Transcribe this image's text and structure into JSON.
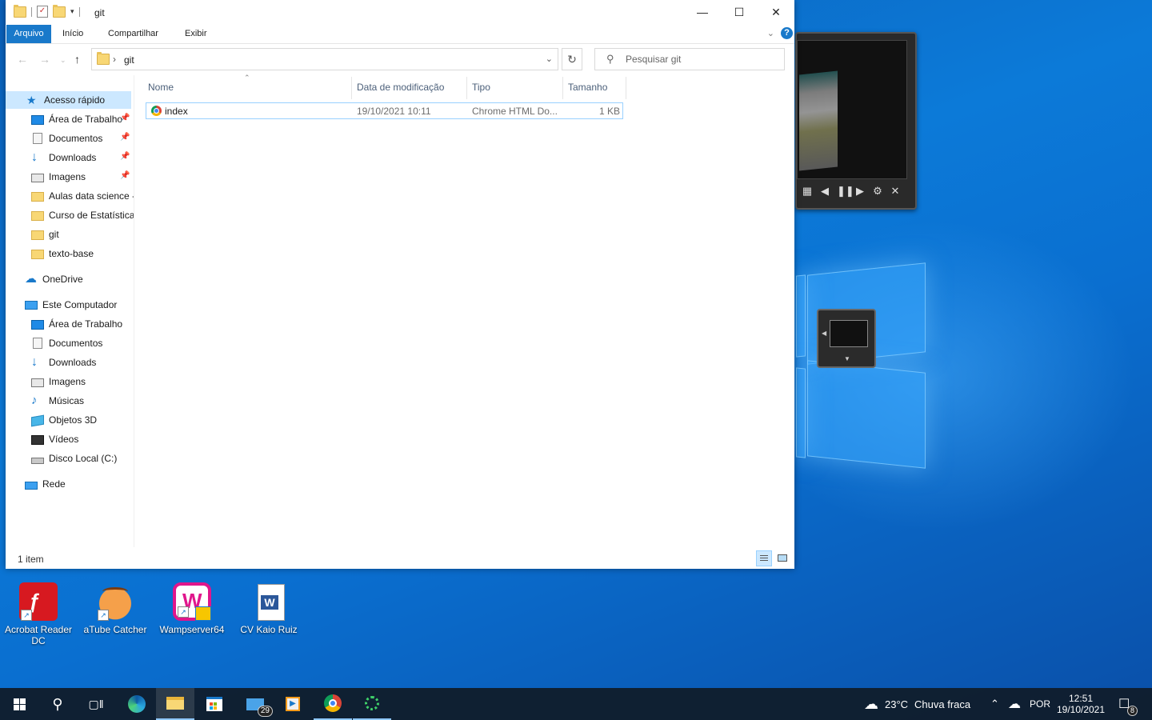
{
  "explorer": {
    "title": "git",
    "ribbon_tabs": [
      "Arquivo",
      "Início",
      "Compartilhar",
      "Exibir"
    ],
    "help_label": "?",
    "address": {
      "path": "git"
    },
    "search": {
      "placeholder": "Pesquisar git"
    },
    "sidebar": {
      "items": [
        {
          "label": "Acesso rápido",
          "icon": "star-icon",
          "pinned": false,
          "selected": true
        },
        {
          "label": "Área de Trabalho",
          "icon": "desktop-icon",
          "pinned": true
        },
        {
          "label": "Documentos",
          "icon": "documents-icon",
          "pinned": true
        },
        {
          "label": "Downloads",
          "icon": "downloads-icon",
          "pinned": true
        },
        {
          "label": "Imagens",
          "icon": "pictures-icon",
          "pinned": true
        },
        {
          "label": "Aulas data science -",
          "icon": "folder-icon",
          "pinned": false
        },
        {
          "label": "Curso de Estatística",
          "icon": "folder-icon",
          "pinned": false
        },
        {
          "label": "git",
          "icon": "folder-icon",
          "pinned": false
        },
        {
          "label": "texto-base",
          "icon": "folder-icon",
          "pinned": false
        },
        {
          "label": "OneDrive",
          "icon": "cloud-icon",
          "pinned": false
        },
        {
          "label": "Este Computador",
          "icon": "computer-icon",
          "pinned": false
        },
        {
          "label": "Área de Trabalho",
          "icon": "desktop-icon",
          "pinned": false
        },
        {
          "label": "Documentos",
          "icon": "documents-icon",
          "pinned": false
        },
        {
          "label": "Downloads",
          "icon": "downloads-icon",
          "pinned": false
        },
        {
          "label": "Imagens",
          "icon": "pictures-icon",
          "pinned": false
        },
        {
          "label": "Músicas",
          "icon": "music-icon",
          "pinned": false
        },
        {
          "label": "Objetos 3D",
          "icon": "3d-objects-icon",
          "pinned": false
        },
        {
          "label": "Vídeos",
          "icon": "videos-icon",
          "pinned": false
        },
        {
          "label": "Disco Local (C:)",
          "icon": "drive-icon",
          "pinned": false
        },
        {
          "label": "Rede",
          "icon": "network-icon",
          "pinned": false
        }
      ]
    },
    "columns": [
      "Nome",
      "Data de modificação",
      "Tipo",
      "Tamanho"
    ],
    "files": [
      {
        "name": "index",
        "modified": "19/10/2021 10:11",
        "type": "Chrome HTML Do...",
        "size": "1 KB",
        "icon": "chrome-icon"
      }
    ],
    "status": "1 item"
  },
  "desktop_icons": [
    {
      "label": "Acrobat Reader DC",
      "icon": "acrobat-icon"
    },
    {
      "label": "aTube Catcher",
      "icon": "atube-icon"
    },
    {
      "label": "Wampserver64",
      "icon": "wampserver-icon"
    },
    {
      "label": "CV Kaio Ruiz",
      "icon": "word-doc-icon"
    }
  ],
  "taskbar": {
    "mail_badge": "29",
    "weather": {
      "temp": "23°C",
      "condition": "Chuva fraca"
    },
    "language": "POR",
    "time": "12:51",
    "date": "19/10/2021",
    "notifications": "8"
  },
  "colors": {
    "accent": "#1979ca",
    "desktop": "#0a6fd0",
    "taskbar": "#101e2d"
  }
}
